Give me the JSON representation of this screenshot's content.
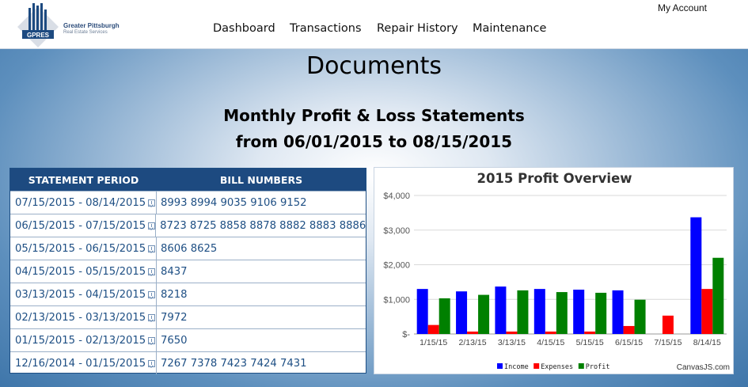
{
  "header": {
    "logo_name": "Greater Pittsburgh",
    "logo_sub": "Real Estate Services",
    "logo_badge": "GPRES",
    "my_account": "My Account",
    "nav": [
      "Dashboard",
      "Transactions",
      "Repair History",
      "Maintenance"
    ]
  },
  "page": {
    "title": "Documents",
    "subtitle_line1": "Monthly Profit & Loss Statements",
    "subtitle_line2": "from 06/01/2015 to 08/15/2015"
  },
  "table": {
    "headers": [
      "STATEMENT PERIOD",
      "BILL NUMBERS"
    ],
    "rows": [
      {
        "period": "07/15/2015 - 08/14/2015",
        "bills": "8993 8994 9035 9106 9152"
      },
      {
        "period": "06/15/2015 - 07/15/2015",
        "bills": "8723 8725 8858 8878 8882 8883 8886"
      },
      {
        "period": "05/15/2015 - 06/15/2015",
        "bills": "8606 8625"
      },
      {
        "period": "04/15/2015 - 05/15/2015",
        "bills": "8437"
      },
      {
        "period": "03/13/2015 - 04/15/2015",
        "bills": "8218"
      },
      {
        "period": "02/13/2015 - 03/13/2015",
        "bills": "7972"
      },
      {
        "period": "01/15/2015 - 02/13/2015",
        "bills": "7650"
      },
      {
        "period": "12/16/2014 - 01/15/2015",
        "bills": "7267 7378 7423 7424 7431"
      }
    ]
  },
  "chart_data": {
    "type": "bar",
    "title": "2015 Profit Overview",
    "categories": [
      "1/15/15",
      "2/13/15",
      "3/13/15",
      "4/15/15",
      "5/15/15",
      "6/15/15",
      "7/15/15",
      "8/14/15"
    ],
    "series": [
      {
        "name": "Income",
        "color": "#0000ff",
        "values": [
          1300,
          1230,
          1370,
          1300,
          1280,
          1260,
          0,
          3370
        ]
      },
      {
        "name": "Expenses",
        "color": "#ff0000",
        "values": [
          260,
          70,
          70,
          70,
          70,
          230,
          530,
          1300
        ]
      },
      {
        "name": "Profit",
        "color": "#008000",
        "values": [
          1030,
          1130,
          1260,
          1210,
          1190,
          990,
          0,
          2200
        ]
      }
    ],
    "yticks": [
      "$-",
      "$1,000",
      "$2,000",
      "$3,000",
      "$4,000"
    ],
    "ylim": [
      0,
      4000
    ],
    "grid": true,
    "legend": "bottom",
    "credit": "CanvasJS.com"
  }
}
